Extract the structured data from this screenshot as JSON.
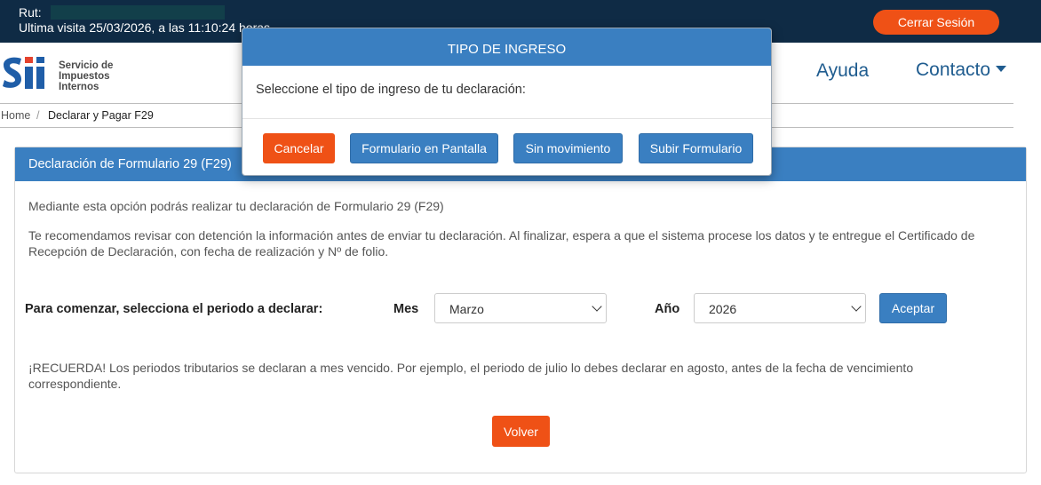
{
  "topbar": {
    "rut_label": "Rut:",
    "last_visit": "Ultima visita 25/03/2026, a las 11:10:24 horas",
    "logout_label": "Cerrar Sesión"
  },
  "logo": {
    "line1": "Servicio de",
    "line2": "Impuestos",
    "line3": "Internos"
  },
  "nav": {
    "help": "Ayuda",
    "contact": "Contacto"
  },
  "breadcrumb": {
    "home": "Home",
    "separator": "/",
    "current": "Declarar y Pagar F29"
  },
  "panel": {
    "title": "Declaración de Formulario 29 (F29)",
    "intro": "Mediante esta opción podrás realizar tu declaración de Formulario 29 (F29)",
    "recommendation": "Te recomendamos revisar con detención la información antes de enviar tu declaración. Al finalizar, espera a que el sistema procese los datos y te entregue el Certificado de Recepción de Declaración, con fecha de realización y Nº de folio.",
    "period_label": "Para comenzar, selecciona el periodo a declarar:",
    "month_label": "Mes",
    "month_value": "Marzo",
    "year_label": "Año",
    "year_value": "2026",
    "accept_label": "Aceptar",
    "reminder": "¡RECUERDA! Los periodos tributarios se declaran a mes vencido. Por ejemplo, el periodo de julio lo debes declarar en agosto, antes de la fecha de vencimiento correspondiente.",
    "back_label": "Volver"
  },
  "modal": {
    "title": "TIPO DE INGRESO",
    "prompt": "Seleccione el tipo de ingreso de tu declaración:",
    "cancel_label": "Cancelar",
    "screen_form_label": "Formulario en Pantalla",
    "no_movement_label": "Sin movimiento",
    "upload_label": "Subir Formulario"
  },
  "colors": {
    "topbar": "#0f2b45",
    "primary_blue": "#3a7fc1",
    "accent_orange": "#ef5116",
    "link_blue": "#1f5c8f"
  }
}
